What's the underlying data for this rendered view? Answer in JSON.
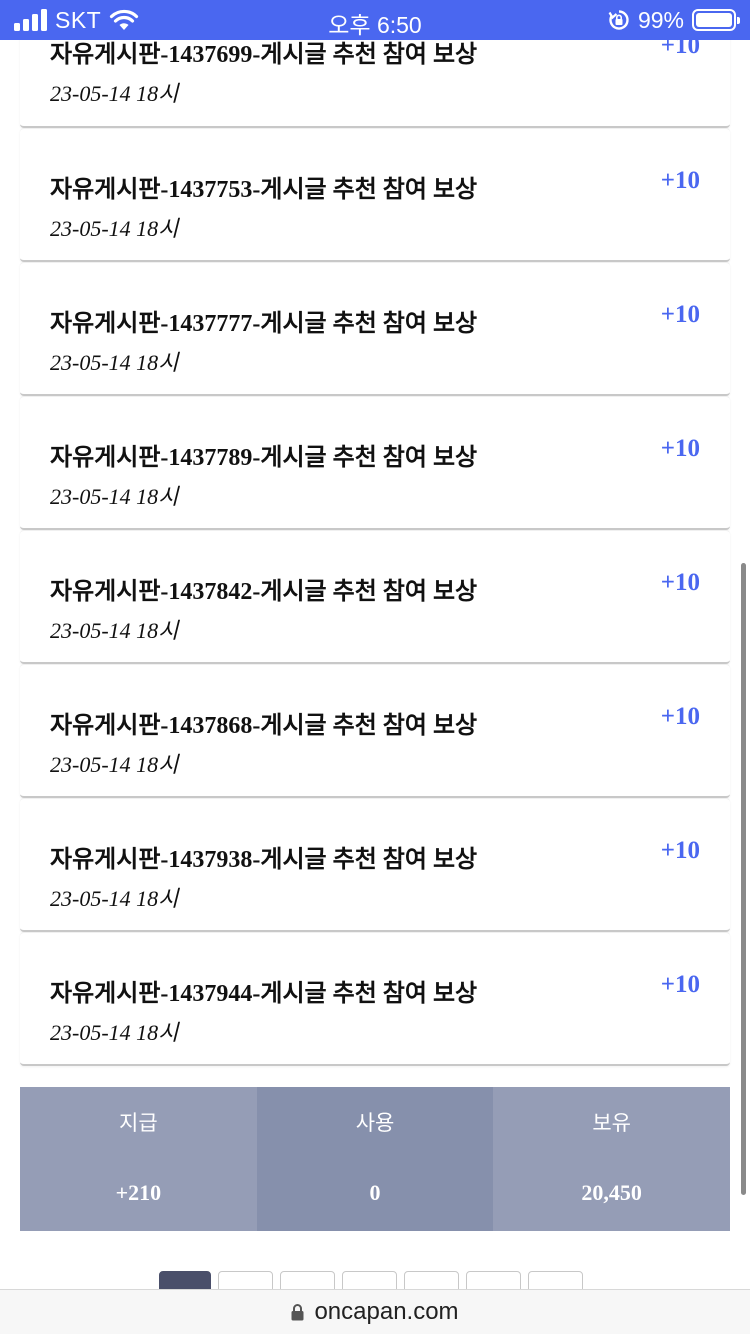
{
  "status_bar": {
    "carrier": "SKT",
    "time": "오후 6:50",
    "battery_percent": "99%"
  },
  "list": {
    "items": [
      {
        "title": "자유게시판-1437699-게시글 추천 참여 보상",
        "date": "23-05-14 18시",
        "points": "+10"
      },
      {
        "title": "자유게시판-1437753-게시글 추천 참여 보상",
        "date": "23-05-14 18시",
        "points": "+10"
      },
      {
        "title": "자유게시판-1437777-게시글 추천 참여 보상",
        "date": "23-05-14 18시",
        "points": "+10"
      },
      {
        "title": "자유게시판-1437789-게시글 추천 참여 보상",
        "date": "23-05-14 18시",
        "points": "+10"
      },
      {
        "title": "자유게시판-1437842-게시글 추천 참여 보상",
        "date": "23-05-14 18시",
        "points": "+10"
      },
      {
        "title": "자유게시판-1437868-게시글 추천 참여 보상",
        "date": "23-05-14 18시",
        "points": "+10"
      },
      {
        "title": "자유게시판-1437938-게시글 추천 참여 보상",
        "date": "23-05-14 18시",
        "points": "+10"
      },
      {
        "title": "자유게시판-1437944-게시글 추천 참여 보상",
        "date": "23-05-14 18시",
        "points": "+10"
      }
    ]
  },
  "summary": {
    "paid_label": "지급",
    "paid_value": "+210",
    "used_label": "사용",
    "used_value": "0",
    "held_label": "보유",
    "held_value": "20,450"
  },
  "browser": {
    "url": "oncapan.com"
  },
  "colors": {
    "accent": "#4a67f0",
    "summary_bg": "#959db6",
    "summary_bg_alt": "#8690ac",
    "page_active": "#4a4f6a"
  },
  "icons": [
    "signal-icon",
    "wifi-icon",
    "rotation-lock-icon",
    "battery-icon",
    "lock-icon"
  ]
}
